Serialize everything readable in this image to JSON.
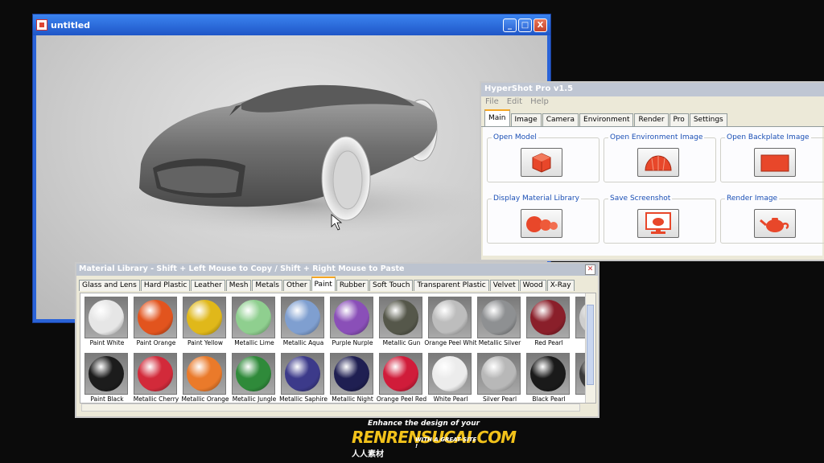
{
  "render_window": {
    "title": "untitled",
    "buttons": {
      "minimize": "_",
      "maximize": "□",
      "close": "X"
    }
  },
  "hypershot": {
    "title": "HyperShot Pro v1.5",
    "menu": [
      "File",
      "Edit",
      "Help"
    ],
    "tabs": [
      "Main",
      "Image",
      "Camera",
      "Environment",
      "Render",
      "Pro",
      "Settings"
    ],
    "active_tab": "Main",
    "actions": [
      {
        "label": "Open Model",
        "icon": "cube-icon"
      },
      {
        "label": "Open Environment Image",
        "icon": "dome-icon"
      },
      {
        "label": "Open Backplate Image",
        "icon": "backplate-icon"
      },
      {
        "label": "Display Material Library",
        "icon": "spheres-icon"
      },
      {
        "label": "Save Screenshot",
        "icon": "monitor-teapot-icon"
      },
      {
        "label": "Render Image",
        "icon": "teapot-icon"
      }
    ],
    "accent_color": "#e8472a"
  },
  "material_library": {
    "title": "Material Library - Shift + Left Mouse to Copy / Shift + Right Mouse to Paste",
    "tabs": [
      "Glass and Lens",
      "Hard Plastic",
      "Leather",
      "Mesh",
      "Metals",
      "Other",
      "Paint",
      "Rubber",
      "Soft Touch",
      "Transparent Plastic",
      "Velvet",
      "Wood",
      "X-Ray"
    ],
    "active_tab": "Paint",
    "rows": [
      [
        {
          "name": "Paint White",
          "color": "#e6e6e6"
        },
        {
          "name": "Paint Orange",
          "color": "#e2541e"
        },
        {
          "name": "Paint Yellow",
          "color": "#e0b81a"
        },
        {
          "name": "Metallic Lime",
          "color": "#8fcf8f"
        },
        {
          "name": "Metallic Aqua",
          "color": "#7f9fd0"
        },
        {
          "name": "Purple Nurple",
          "color": "#8a4fb8"
        },
        {
          "name": "Metallic Gun",
          "color": "#55574a"
        },
        {
          "name": "Orange Peel Whit",
          "color": "#bdbdbd"
        },
        {
          "name": "Metallic Silver",
          "color": "#8e9092"
        },
        {
          "name": "Red Pearl",
          "color": "#8a1f2a"
        },
        {
          "name": "Wh",
          "color": "#cfcfcf"
        }
      ],
      [
        {
          "name": "Paint Black",
          "color": "#1c1c1c"
        },
        {
          "name": "Metallic Cherry",
          "color": "#d22a3a"
        },
        {
          "name": "Metallic Orange",
          "color": "#ea7a2a"
        },
        {
          "name": "Metallic Jungle",
          "color": "#2f8a3a"
        },
        {
          "name": "Metallic Saphire",
          "color": "#3c3a8a"
        },
        {
          "name": "Metallic Night",
          "color": "#1f1f52"
        },
        {
          "name": "Orange Peel Red",
          "color": "#d01c3a"
        },
        {
          "name": "White Pearl",
          "color": "#ececec"
        },
        {
          "name": "Silver Pearl",
          "color": "#b8b8b8"
        },
        {
          "name": "Black Pearl",
          "color": "#1a1a1a"
        },
        {
          "name": "St",
          "color": "#3a3a3a"
        }
      ]
    ]
  },
  "watermark": {
    "tagline": "Enhance the design of your",
    "brand": "RENRENSUCAI.COM",
    "chinese": "人人素材",
    "side": "WITH A GREAT SITE !"
  }
}
